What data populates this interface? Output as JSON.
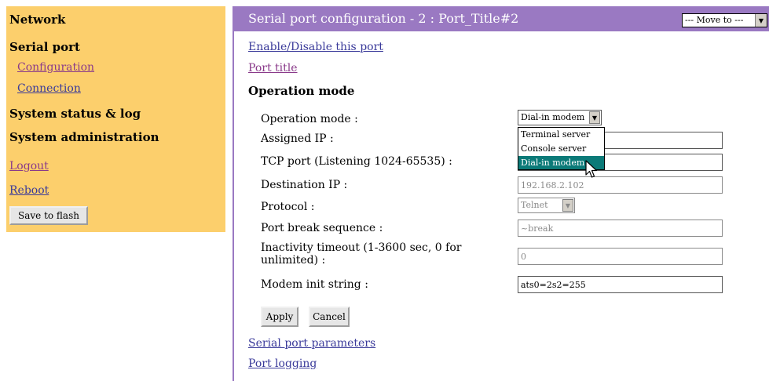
{
  "sidebar": {
    "network": "Network",
    "serial_port": "Serial port",
    "configuration": "Configuration",
    "connection": "Connection",
    "system_status": "System status & log",
    "system_admin": "System administration",
    "logout": "Logout",
    "reboot": "Reboot",
    "save_to_flash": "Save to flash"
  },
  "header": {
    "title": "Serial port configuration - 2 : Port_Title#2",
    "move_to": "--- Move to ---"
  },
  "links": {
    "enable_disable": "Enable/Disable this port",
    "port_title": "Port title",
    "serial_params": "Serial port parameters",
    "port_logging": "Port logging"
  },
  "operation": {
    "section_title": "Operation mode",
    "mode_label": "Operation mode :",
    "mode_value": "Dial-in modem",
    "mode_options": [
      "Terminal server",
      "Console server",
      "Dial-in modem"
    ],
    "assigned_ip_label": "Assigned IP :",
    "assigned_ip_value": "",
    "tcp_port_label": "TCP port (Listening 1024-65535) :",
    "tcp_port_value": "",
    "dest_ip_label": "Destination IP :",
    "dest_ip_value": "192.168.2.102",
    "protocol_label": "Protocol :",
    "protocol_value": "Telnet",
    "break_label": "Port break sequence :",
    "break_value": "~break",
    "inactivity_label_1": "Inactivity timeout (1-3600 sec, 0 for",
    "inactivity_label_2": "unlimited) :",
    "inactivity_value": "0",
    "modem_label": "Modem init string :",
    "modem_value": "ats0=2s2=255"
  },
  "buttons": {
    "apply": "Apply",
    "cancel": "Cancel"
  },
  "colors": {
    "sidebar_bg": "#fccf6c",
    "header_bg": "#9a79c2",
    "selected_option": "#0b7a78"
  }
}
